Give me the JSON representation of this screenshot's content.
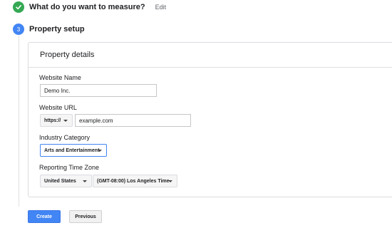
{
  "steps": {
    "step1": {
      "title": "What do you want to measure?",
      "edit_label": "Edit"
    },
    "step2": {
      "number": "3",
      "title": "Property setup"
    }
  },
  "card": {
    "title": "Property details",
    "website_name": {
      "label": "Website Name",
      "value": "Demo Inc."
    },
    "website_url": {
      "label": "Website URL",
      "protocol": "https://",
      "value": "example.com"
    },
    "industry_category": {
      "label": "Industry Category",
      "selected": "Arts and Entertainment"
    },
    "reporting_time_zone": {
      "label": "Reporting Time Zone",
      "country": "United States",
      "time_zone": "(GMT-08:00) Los Angeles Time"
    }
  },
  "actions": {
    "create_label": "Create",
    "previous_label": "Previous"
  },
  "colors": {
    "accent": "#4285f4",
    "success": "#34a853"
  }
}
